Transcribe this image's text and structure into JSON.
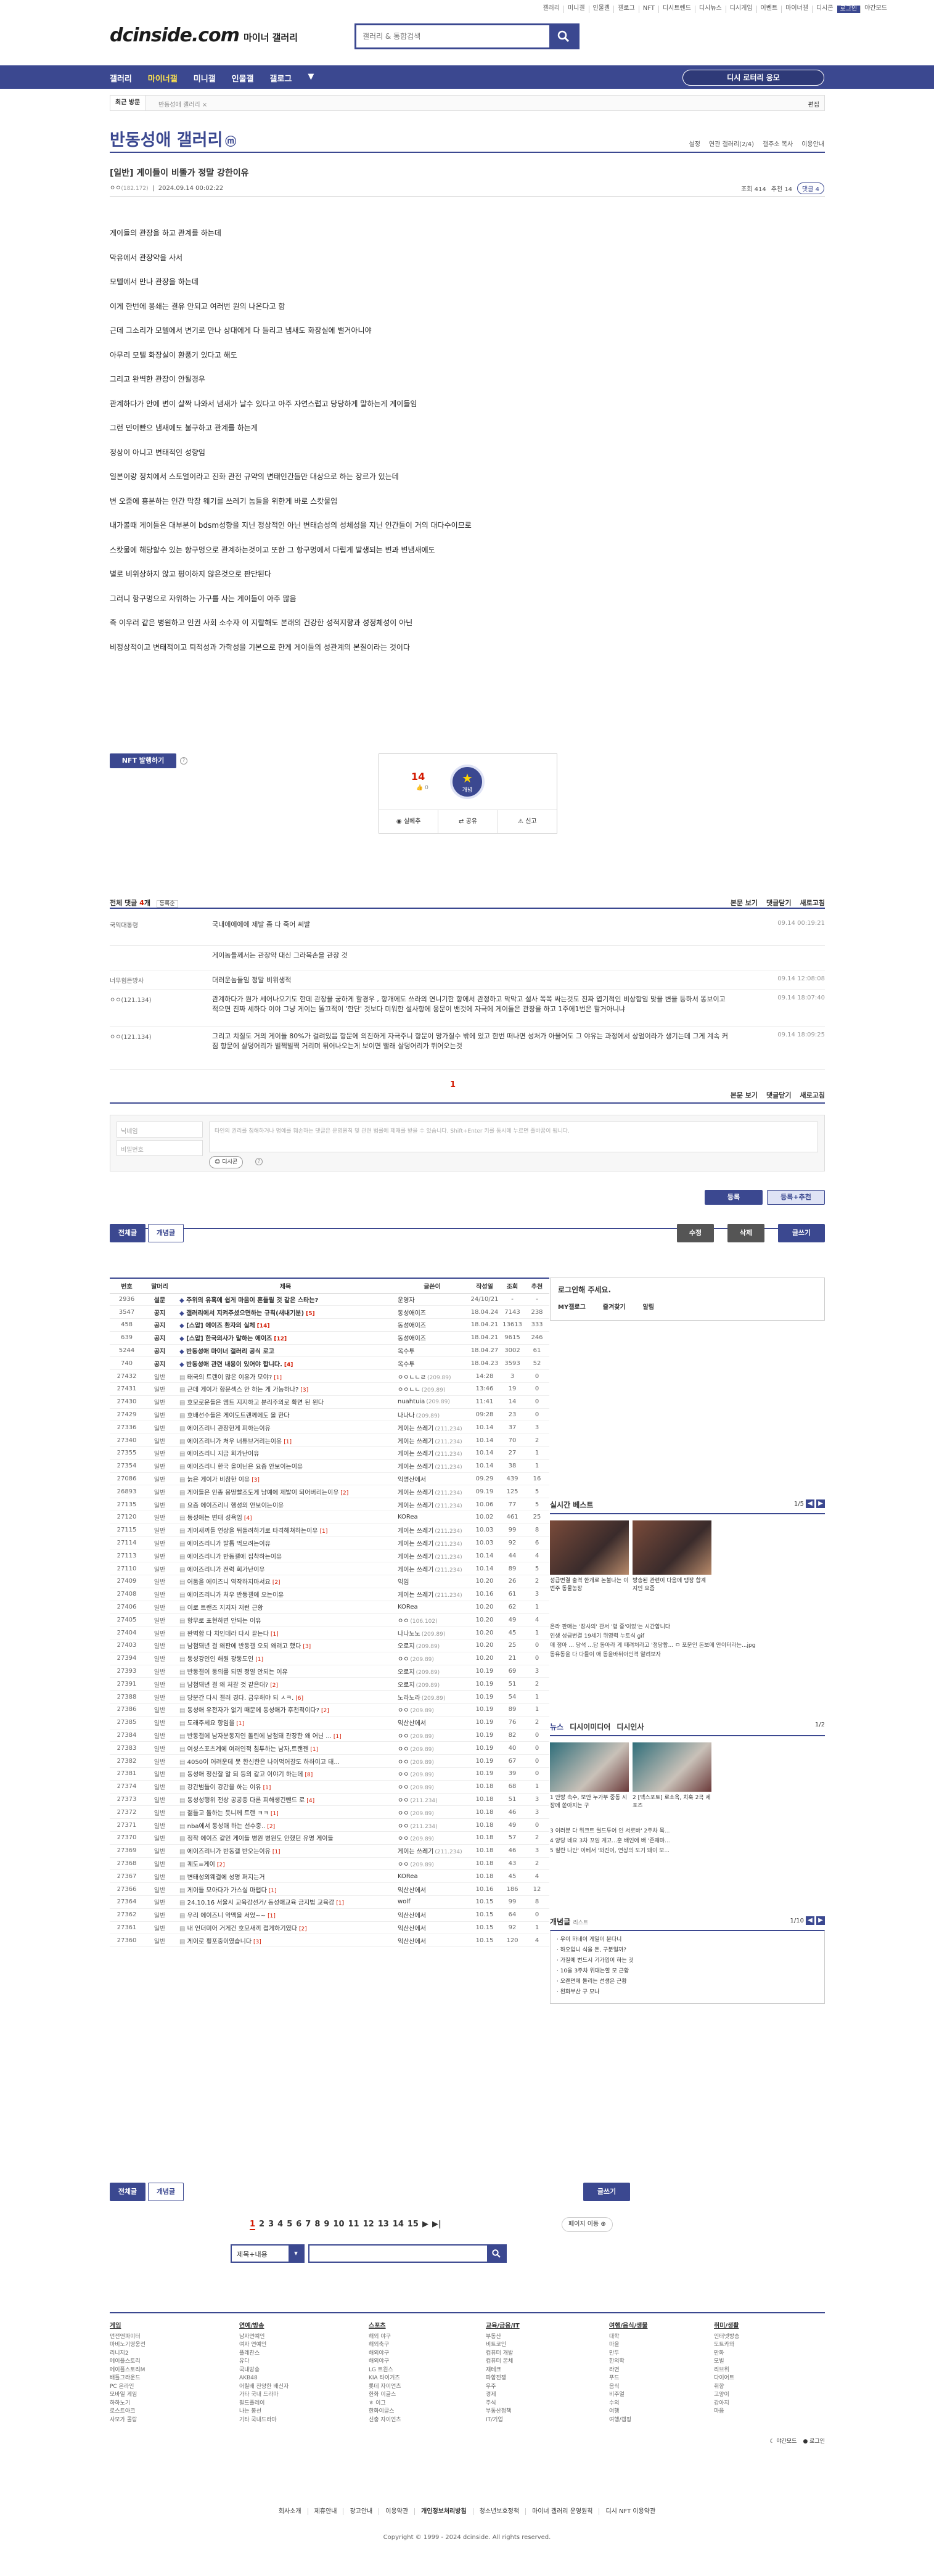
{
  "topnav": {
    "links": [
      "갤러리",
      "미니갤",
      "인물갤",
      "갤로그",
      "NFT",
      "디시트렌드",
      "디시뉴스",
      "디시게임",
      "이벤트",
      "마이너갤",
      "디시콘",
      "로그인",
      "야간모드"
    ]
  },
  "header": {
    "logo": "dcinside.com",
    "logo_sub": "마이너 갤러리",
    "search_placeholder": "갤러리 & 통합검색"
  },
  "gnb": {
    "menu": [
      "갤러리",
      "마이너갤",
      "미니갤",
      "인물갤",
      "갤로그"
    ],
    "visit": "디시 로터리 응모"
  },
  "subnav": {
    "recent": "최근 방문",
    "crumb": "반동성애 갤러리",
    "edit": "편집"
  },
  "gallery": {
    "title": "반동성애 갤러리",
    "badge": "ⓜ",
    "tools": [
      "설정",
      "연관 갤러리(2/4)",
      "갤주소 복사",
      "이용안내"
    ]
  },
  "post": {
    "title": "[일반] 게이들이 비뚤가 정말 강한이유",
    "author": "ㅇㅇ",
    "ip": "(182.172)",
    "date": "2024.09.14 00:02:22",
    "views": "조회 414",
    "rec": "추천 14",
    "comments": "댓글 4",
    "body": [
      "게이들의 관장을 하고 관계를 하는데",
      "막유에서 관장약을 사서",
      "모텔에서 만나 관장을 하는데",
      "이게 한번에 봉쇄는 결유 안되고 여러번 원의 나온다고 함",
      "근데 그소리가 모텔에서 변기로 만나 상대에게 다 들리고 냄새도 화장실에 밸거아니야",
      "아무리 모텔 화장실이 환풍기 있다고 해도",
      "그리고 완벽한 관장이 안될경우",
      "관계하다가 안에 변이 살짝 나와서 냄새가 날수 있다고 아주 자연스럽고 당당하게 말하는게 게이들임",
      "그런 민어빤으 냄새에도 불구하고 관계를 하는게",
      "정상이 아니고 변태적인 성향임",
      "일본이랑 정치에서 스토얼이라고 진화 관전 규약의 변태인간들만 대상으로 하는 장르가 있는데",
      "변 오줌에 흥분하는 인간 막장 웨기를 쓰레기 놈들을 위한게 바로 스캇물임",
      "내가볼때 게이들은 대부분이 bdsm성향을 지닌 정상적인 아닌 변태습성의 성체성을 지닌 인간들이 거의 대다수이므로",
      "스캇물에 해당할수 있는 항구멍으로 관계하는것이고 또한 그 항구멍에서 다립게 발생되는 변과 변냄새에도",
      "별로 비위상하지 않고 평이하지 않은것으로 판단된다",
      "그러니 항구멍으로 자위하는 가구를 사는 게이들이 아주 많음",
      "즉 이우러 같은 병원하고 인권 사회 소수자 이 지랄해도 본래의 건강한 성적지향과 성정체성이 아닌",
      "비정상적이고 변태적이고 퇴적성과 가학성을 기본으로 한게 게이들의 성관계의 본질이라는 것이다"
    ]
  },
  "nft": {
    "label": "NFT 발행하기"
  },
  "recommend": {
    "count": "14",
    "sub": "0",
    "star_label": "개념",
    "actions": [
      "실베추",
      "공유",
      "신고"
    ]
  },
  "comments": {
    "title": "전체 댓글",
    "count": "4",
    "sort": "등록순",
    "tools": [
      "본문 보기",
      "댓글닫기",
      "새로고침"
    ],
    "items": [
      {
        "writer": "국익대통령",
        "text": "국내에에에에 제발 좀 다 죽어 씨발",
        "date": "09.14 00:19:21"
      },
      {
        "writer": "",
        "text": "게이놈들께서는 관장약 대신 그라목손을 관장 것",
        "date": ""
      },
      {
        "writer": "너무힘든방사",
        "text": "더러운놈들임 정말 비위생적",
        "date": "09.14 12:08:08"
      },
      {
        "writer": "ㅇㅇ(121.134)",
        "text": "관계하다가 뭔가 세어나오기도 한데 관장을 궁하게 할경우 , 항개에도 쓰라의 연니기한 항에서 관정하고 막막고 설사 쪽쪽 싸는것도 진짜 엽기적인 비상함임 맞을 변을 등하서 똥보이고 적으면 진짜 세하다 이야 그냥 게이는 똘끄적이 '한단' 것보다 미워한 설사항에 웅문이 밴것에 자극에 게이들은 관장을 하고 1주에1번은 할거아니냐",
        "date": "09.14 18:07:40"
      },
      {
        "writer": "ㅇㅇ(121.134)",
        "text": "그리고 치질도 거의 게이들 80%가 걸려있음 항문에 의진하게 자극주니 항문이 망가질수 밖에 있고 한번 떠나면 성처가 아물어도 그 야유는 과정에서 상엄이라가 생기는데 그게 계속 커짐 항문에 살덩어리가 빌쩍빌쩍 거리며 튀어나오는게 보이면 빨래 살덩어리가 뛰어오는것",
        "date": "09.14 18:09:25"
      }
    ],
    "page": "1",
    "name_placeholder": "닉네임",
    "pw_placeholder": "비밀번호",
    "textarea_placeholder": "타인의 권리를 침해하거나 명예를 훼손하는 댓글은 운영원칙 및 관련 법률에 제재를 받을 수 있습니다. Shift+Enter 키를 동시에 누르면 줄바꿈이 됩니다.",
    "dccon": "디시콘",
    "submit": "등록",
    "submit_rec": "등록+추천"
  },
  "listtabs": {
    "all": "전체글",
    "concept": "개념글",
    "edit": "수정",
    "del": "삭제",
    "write": "글쓰기"
  },
  "list": {
    "headers": [
      "번호",
      "말머리",
      "제목",
      "글쓴이",
      "작성일",
      "조회",
      "추천"
    ],
    "rows": [
      {
        "no": "2936",
        "head": "설문",
        "title": "주위의 유혹에 쉽게 마음이 흔들릴 것 같은 스타는?",
        "cm": "",
        "writer": "운영자",
        "ip": "",
        "date": "24/10/21",
        "views": "-",
        "rec": "-",
        "notice": true
      },
      {
        "no": "3547",
        "head": "공지",
        "title": "갤러리에서 지켜주셨으면하는 규칙(새내기분)",
        "cm": "[5]",
        "writer": "동성애이즈",
        "ip": "",
        "date": "18.04.24",
        "views": "7143",
        "rec": "238",
        "notice": true
      },
      {
        "no": "458",
        "head": "공지",
        "title": "[스압] 에이즈 환자의 실체",
        "cm": "[14]",
        "writer": "동성애이즈",
        "ip": "",
        "date": "18.04.21",
        "views": "13613",
        "rec": "333",
        "notice": true
      },
      {
        "no": "639",
        "head": "공지",
        "title": "[스압] 한국의사가 말하는 에이즈",
        "cm": "[12]",
        "writer": "동성애이즈",
        "ip": "",
        "date": "18.04.21",
        "views": "9615",
        "rec": "246",
        "notice": true
      },
      {
        "no": "5244",
        "head": "공지",
        "title": "반동성애 마이너 갤러리 공식 로고",
        "cm": "",
        "writer": "옥수투",
        "ip": "",
        "date": "18.04.27",
        "views": "3002",
        "rec": "61",
        "notice": true
      },
      {
        "no": "740",
        "head": "공지",
        "title": "반동성애 관련 내용이 있어야 합니다.",
        "cm": "[4]",
        "writer": "옥수투",
        "ip": "",
        "date": "18.04.23",
        "views": "3593",
        "rec": "52",
        "notice": true
      },
      {
        "no": "27432",
        "head": "일반",
        "title": "태국의 트랜이 많은 이유가 모야?",
        "cm": "[1]",
        "writer": "ㅇㅇㄴㄴㄹ",
        "ip": "(209.89)",
        "date": "14:28",
        "views": "3",
        "rec": "0"
      },
      {
        "no": "27431",
        "head": "일반",
        "title": "근데 게이가 항문섹스 안 하는 게 가능하나?",
        "cm": "[3]",
        "writer": "ㅇㅇㄴㄴ",
        "ip": "(209.89)",
        "date": "13:46",
        "views": "19",
        "rec": "0"
      },
      {
        "no": "27430",
        "head": "일반",
        "title": "호모로운들은 엠트 지지하고 분리주의로 확면 된 왼다",
        "cm": "",
        "writer": "nuahtuia",
        "ip": "(209.89)",
        "date": "11:41",
        "views": "14",
        "rec": "0"
      },
      {
        "no": "27429",
        "head": "일반",
        "title": "호배선수들은 게이도트랜께에도 올 한다",
        "cm": "",
        "writer": "나나나",
        "ip": "(209.89)",
        "date": "09:28",
        "views": "23",
        "rec": "0"
      },
      {
        "no": "27336",
        "head": "일반",
        "title": "에이즈리니 관장한게 피하는이유",
        "cm": "",
        "writer": "게이는 쓰레기",
        "ip": "(211.234)",
        "date": "10.14",
        "views": "37",
        "rec": "3"
      },
      {
        "no": "27340",
        "head": "일반",
        "title": "에이즈리니가 처우 너튜브거리는이유",
        "cm": "[1]",
        "writer": "게이는 쓰레기",
        "ip": "(211.234)",
        "date": "10.14",
        "views": "70",
        "rec": "2"
      },
      {
        "no": "27355",
        "head": "일반",
        "title": "에이즈리니 지금 회가난이유",
        "cm": "",
        "writer": "게이는 쓰레기",
        "ip": "(211.234)",
        "date": "10.14",
        "views": "27",
        "rec": "1"
      },
      {
        "no": "27354",
        "head": "일반",
        "title": "에이즈리니 한국 올이닌은 요즘 안보이는이유",
        "cm": "",
        "writer": "게이는 쓰레기",
        "ip": "(211.234)",
        "date": "10.14",
        "views": "38",
        "rec": "1"
      },
      {
        "no": "27086",
        "head": "일반",
        "title": "늙은 게이가 비참한 이유",
        "cm": "[3]",
        "writer": "익명산에서",
        "ip": "",
        "date": "09.29",
        "views": "439",
        "rec": "16"
      },
      {
        "no": "26893",
        "head": "일반",
        "title": "게이들은 인종 몽땅빨조도게 남예에 제발이 되어버리는이유",
        "cm": "[2]",
        "writer": "게이는 쓰레기",
        "ip": "(211.234)",
        "date": "09.19",
        "views": "125",
        "rec": "5"
      },
      {
        "no": "27135",
        "head": "일반",
        "title": "요즘 에이즈리니 행성의 안보이는이유",
        "cm": "",
        "writer": "게이는 쓰레기",
        "ip": "(211.234)",
        "date": "10.06",
        "views": "77",
        "rec": "5"
      },
      {
        "no": "27120",
        "head": "일반",
        "title": "동성애는 변태 성욕임",
        "cm": "[4]",
        "writer": "KOReа",
        "ip": "",
        "date": "10.02",
        "views": "461",
        "rec": "25"
      },
      {
        "no": "27115",
        "head": "일반",
        "title": "게이새끼들 연상을 뒤돌려하기로 타격해쳐하는이유",
        "cm": "[1]",
        "writer": "게이는 쓰레기",
        "ip": "(211.234)",
        "date": "10.03",
        "views": "99",
        "rec": "8"
      },
      {
        "no": "27114",
        "head": "일반",
        "title": "에이즈리니가 발톱 먹으려는이유",
        "cm": "",
        "writer": "게이는 쓰레기",
        "ip": "(211.234)",
        "date": "10.03",
        "views": "92",
        "rec": "6"
      },
      {
        "no": "27113",
        "head": "일반",
        "title": "에이즈리니가 반동갤에 집착하는이유",
        "cm": "",
        "writer": "게이는 쓰레기",
        "ip": "(211.234)",
        "date": "10.14",
        "views": "44",
        "rec": "4"
      },
      {
        "no": "27110",
        "head": "일반",
        "title": "에이즈리니가 전력 회가난이유",
        "cm": "",
        "writer": "게이는 쓰레기",
        "ip": "(211.234)",
        "date": "10.14",
        "views": "89",
        "rec": "5"
      },
      {
        "no": "27409",
        "head": "일반",
        "title": "어둠을 에이즈니 역작하지마서요",
        "cm": "[2]",
        "writer": "익임",
        "ip": "",
        "date": "10.20",
        "views": "26",
        "rec": "2"
      },
      {
        "no": "27408",
        "head": "일반",
        "title": "에이즈리니가 처우 반동갤에 오는이유",
        "cm": "",
        "writer": "게이는 쓰레기",
        "ip": "(211.234)",
        "date": "10.16",
        "views": "61",
        "rec": "3"
      },
      {
        "no": "27406",
        "head": "일반",
        "title": "이로 트랜즈 지지자 저런 근황",
        "cm": "",
        "writer": "KOReа",
        "ip": "",
        "date": "10.20",
        "views": "62",
        "rec": "1"
      },
      {
        "no": "27405",
        "head": "일반",
        "title": "항무로 표현하면 안되는 이유",
        "cm": "",
        "writer": "ㅇㅇ",
        "ip": "(106.102)",
        "date": "10.20",
        "views": "49",
        "rec": "4"
      },
      {
        "no": "27404",
        "head": "일반",
        "title": "완벽합 다 치인데라 다시 끝는다",
        "cm": "[1]",
        "writer": "나나노노",
        "ip": "(209.89)",
        "date": "10.20",
        "views": "45",
        "rec": "1"
      },
      {
        "no": "27403",
        "head": "일반",
        "title": "남첨돼년 걸 왜판에 반동갤 오되 왜려고 했다",
        "cm": "[3]",
        "writer": "오로지",
        "ip": "(209.89)",
        "date": "10.20",
        "views": "25",
        "rec": "0"
      },
      {
        "no": "27394",
        "head": "일반",
        "title": "동성강인인 해원 광동도인",
        "cm": "[1]",
        "writer": "ㅇㅇ",
        "ip": "(209.89)",
        "date": "10.20",
        "views": "21",
        "rec": "0"
      },
      {
        "no": "27393",
        "head": "일반",
        "title": "반동갤이 동의를 되면 정알 안되는 이유",
        "cm": "",
        "writer": "오로지",
        "ip": "(209.89)",
        "date": "10.19",
        "views": "69",
        "rec": "3"
      },
      {
        "no": "27391",
        "head": "일반",
        "title": "남첨돼년 걸 왜 처갈 것 같은대?",
        "cm": "[2]",
        "writer": "오로지",
        "ip": "(209.89)",
        "date": "10.19",
        "views": "51",
        "rec": "2"
      },
      {
        "no": "27388",
        "head": "일반",
        "title": "당분간 다시 갤러 경다. 금우해야 되 ㅅㅋ.",
        "cm": "[6]",
        "writer": "노라노라",
        "ip": "(209.89)",
        "date": "10.19",
        "views": "54",
        "rec": "1"
      },
      {
        "no": "27386",
        "head": "일반",
        "title": "동성애 유전자가 없기 때문에 동성애가 후천적이다?",
        "cm": "[2]",
        "writer": "ㅇㅇ",
        "ip": "(209.89)",
        "date": "10.19",
        "views": "89",
        "rec": "1"
      },
      {
        "no": "27385",
        "head": "일반",
        "title": "도래주세요 항임을",
        "cm": "[1]",
        "writer": "익산산에서",
        "ip": "",
        "date": "10.19",
        "views": "76",
        "rec": "2"
      },
      {
        "no": "27384",
        "head": "일반",
        "title": "반동갤에 남자분동지인 돌린에 남첨돼 관장한 왜 어닌 ...",
        "cm": "[1]",
        "writer": "ㅇㅇ",
        "ip": "(209.89)",
        "date": "10.19",
        "views": "82",
        "rec": "0"
      },
      {
        "no": "27383",
        "head": "일반",
        "title": "여성스포츠계에 여러인적 침투하는 남자,트랜젠",
        "cm": "[1]",
        "writer": "ㅇㅇ",
        "ip": "(209.89)",
        "date": "10.19",
        "views": "40",
        "rec": "0"
      },
      {
        "no": "27382",
        "head": "일반",
        "title": "4050이 어려운데 못 한신한은 나이먹어갈도 하하이고 태...",
        "cm": "",
        "writer": "ㅇㅇ",
        "ip": "(209.89)",
        "date": "10.19",
        "views": "67",
        "rec": "0"
      },
      {
        "no": "27381",
        "head": "일반",
        "title": "동성애 정신잘 알 되 등의 같고 이야기 하는데",
        "cm": "[8]",
        "writer": "ㅇㅇ",
        "ip": "(209.89)",
        "date": "10.19",
        "views": "39",
        "rec": "0"
      },
      {
        "no": "27374",
        "head": "일반",
        "title": "강간범들이 강간을 하는 이유",
        "cm": "[1]",
        "writer": "ㅇㅇ",
        "ip": "(209.89)",
        "date": "10.18",
        "views": "68",
        "rec": "1"
      },
      {
        "no": "27373",
        "head": "일반",
        "title": "동성성행위 전상 공공중 다른 피해생긴뺀드 로",
        "cm": "[4]",
        "writer": "ㅇㅇ",
        "ip": "(211.234)",
        "date": "10.18",
        "views": "51",
        "rec": "3"
      },
      {
        "no": "27372",
        "head": "일반",
        "title": "젊들고 돌하는 듯니께 트랜 ㅋㅋ",
        "cm": "[1]",
        "writer": "ㅇㅇ",
        "ip": "(209.89)",
        "date": "10.18",
        "views": "46",
        "rec": "3"
      },
      {
        "no": "27371",
        "head": "일반",
        "title": "nba에서 동성애 하는 선수중..",
        "cm": "[2]",
        "writer": "ㅇㅇ",
        "ip": "(211.234)",
        "date": "10.18",
        "views": "49",
        "rec": "0"
      },
      {
        "no": "27370",
        "head": "일반",
        "title": "정작 에이즈 같인 게이들 병원 병원도 안했던 유명 게이들",
        "cm": "",
        "writer": "ㅇㅇ",
        "ip": "(209.89)",
        "date": "10.18",
        "views": "57",
        "rec": "2"
      },
      {
        "no": "27369",
        "head": "일반",
        "title": "에이즈리니가 반동갤 반오는이유",
        "cm": "[1]",
        "writer": "게이는 쓰레기",
        "ip": "(211.234)",
        "date": "10.18",
        "views": "46",
        "rec": "3"
      },
      {
        "no": "27368",
        "head": "일반",
        "title": "퀘도=게이",
        "cm": "[2]",
        "writer": "ㅇㅇ",
        "ip": "(209.89)",
        "date": "10.18",
        "views": "43",
        "rec": "2"
      },
      {
        "no": "27367",
        "head": "일반",
        "title": "변태성외웨결에 성명 퍼지는거",
        "cm": "",
        "writer": "KOReа",
        "ip": "",
        "date": "10.18",
        "views": "45",
        "rec": "4"
      },
      {
        "no": "27366",
        "head": "일반",
        "title": "게이들 모아다가 가스실 마렵다",
        "cm": "[1]",
        "writer": "익산산에서",
        "ip": "",
        "date": "10.16",
        "views": "186",
        "rec": "12"
      },
      {
        "no": "27364",
        "head": "일반",
        "title": "24.10.16 서울시 교육감선거/ 동성애교육 금지법 교육감",
        "cm": "[1]",
        "writer": "wolf",
        "ip": "",
        "date": "10.15",
        "views": "99",
        "rec": "8"
      },
      {
        "no": "27362",
        "head": "일반",
        "title": "우리 에이즈니 악맥을 서었~~",
        "cm": "[1]",
        "writer": "익산산에서",
        "ip": "",
        "date": "10.15",
        "views": "64",
        "rec": "0"
      },
      {
        "no": "27361",
        "head": "일반",
        "title": "내 언더미어 거게건 호모새끼 접게하기였다",
        "cm": "[2]",
        "writer": "익산산에서",
        "ip": "",
        "date": "10.15",
        "views": "92",
        "rec": "1"
      },
      {
        "no": "27360",
        "head": "일반",
        "title": "게이로 횡포중이였습니다",
        "cm": "[3]",
        "writer": "익산산에서",
        "ip": "",
        "date": "10.15",
        "views": "120",
        "rec": "4"
      }
    ]
  },
  "side": {
    "login_title": "로그인해 주세요.",
    "login_btns": [
      "MY갤로그",
      "즐겨찾기",
      "알림"
    ],
    "realtime": {
      "title": "실시간 베스트",
      "page": "1/5",
      "items": [
        {
          "cap": "성급변결 출격 한개로 논불나는 이번주 동물농장"
        },
        {
          "cap": "방송된 관련이 다음에 맹장 합계 지인 요즘"
        }
      ],
      "more": [
        "온라 판매는 '장사의' 관서 '령 중'이었'는 시간합니다",
        "인생 성급변결 19세기 위영력 누토식 gif",
        "애 정아 ... 당석 ...답 동아라 게 때려처라고 '정당합... ㅁ 포문인 돈보에 안이터라는...jpg",
        "동유동을 다 다들이 애 동을바뒤아인격 알려보자"
      ]
    },
    "news": {
      "tabs": [
        "뉴스",
        "디시이미디어",
        "디시인사",
        "1/2"
      ],
      "items": [
        {
          "cap": "1 안방 속수, 보안 누가부 중동 시장에 쏟아지는 구"
        },
        {
          "cap": "2 [맥스포토] 로소옥, 치훅 2곡 세 포즈"
        }
      ],
      "more": [
        "3 이러분 다 위크트 월드투어 인 서로바' 2주차 목...",
        "4 양당 네요 3차 꼬임 게고...훈 배인에 배 '존재마...",
        "5 칠란 나만' 이베서 '와진이, 연상의 도기 돼이 보..."
      ]
    },
    "concept": {
      "title": "개념글",
      "sub": "리스트",
      "page": "1/10",
      "items": [
        "우이 하네이 게일이 분다니",
        "하오업니 식을 돈, 구분일까?",
        "가질에 번드시 기가입이 하는 것",
        "10을 3주차 위대는할 모 근황",
        "오랜면에 돌리는 선생은 근황",
        "왼화부산 구 모나"
      ]
    }
  },
  "pager": {
    "pages": [
      "1",
      "2",
      "3",
      "4",
      "5",
      "6",
      "7",
      "8",
      "9",
      "10",
      "11",
      "12",
      "13",
      "14",
      "15"
    ],
    "prev": "",
    "next": "▶",
    "last": "▶|",
    "jump": "페이지 이동 ⊕"
  },
  "search": {
    "type": "제목+내용"
  },
  "footer": {
    "cols": [
      {
        "h": "게임",
        "items": [
          "던전앤파이터",
          "마비노기영웅전",
          "리니지2",
          "메이플스토리",
          "메이플스토리M",
          "배틀그라운드",
          "PC 온라인",
          "모바일 게임",
          "하하노기",
          "로스트아크",
          "사모가 콜랑"
        ]
      },
      {
        "h": "연예/방송",
        "items": [
          "남자연예인",
          "여자 연예인",
          "플레찬스",
          "유다",
          "국내방송",
          "AKB48",
          "어릴배 찬양한 배신자",
          "가타 국내 드라마",
          "필드플레이",
          "나는 봉선",
          "기타 국내드라마"
        ]
      },
      {
        "h": "스포츠",
        "items": [
          "해외 야구",
          "해외축구",
          "해외야구",
          "해외야구",
          "LG 트윈스",
          "KIA 타이거즈",
          "롯데 자이언츠",
          "한화 이글스",
          "ㅎ 이그",
          "한화이글스",
          "신충 자이언츠"
        ]
      },
      {
        "h": "교육/금융/IT",
        "items": [
          "부동산",
          "비트코인",
          "컴퓨터 개발",
          "컴퓨터 본체",
          "재테크",
          "파함전쟁",
          "우주",
          "경제",
          "주식",
          "부동산정책",
          "IT/기업"
        ]
      },
      {
        "h": "여행/음식/생물",
        "items": [
          "대학",
          "마을",
          "만두",
          "한의학",
          "라면",
          "푸드",
          "음식",
          "비주얼",
          "수의",
          "여행",
          "여행/캠핑"
        ]
      },
      {
        "h": "취미/생활",
        "items": [
          "인터넷방송",
          "도트카와",
          "만화",
          "모빌",
          "리브위",
          "다이어트",
          "취향",
          "고양이",
          "강아지",
          "마음"
        ]
      }
    ],
    "mode": "야간모드",
    "login": "로그인",
    "links": [
      "회사소개",
      "제휴안내",
      "광고안내",
      "이용약관",
      "개인정보처리방침",
      "청소년보호정책",
      "마이너 갤러리 운영원칙",
      "디시 NFT 이용약관"
    ],
    "copy": "Copyright © 1999 - 2024 dcinside. All rights reserved."
  }
}
